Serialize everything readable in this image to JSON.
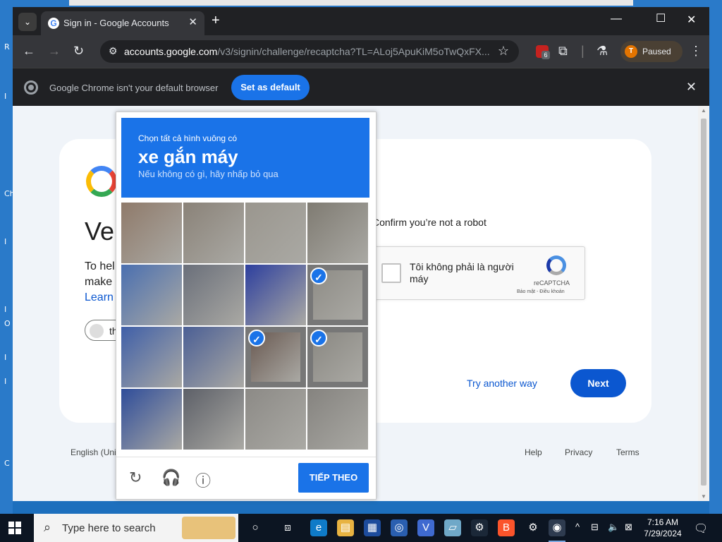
{
  "desktop": {
    "left_glyphs": [
      "R",
      "I",
      "Ch",
      "I",
      "I",
      "O",
      "I",
      "I",
      "C"
    ]
  },
  "tab": {
    "title": "Sign in - Google Accounts",
    "favicon": "G",
    "close": "✕"
  },
  "toolbar": {
    "url_host": "accounts.google.com",
    "url_path": "/v3/signin/challenge/recaptcha?TL=ALoj5ApuKiM5oTwQxFX...",
    "extension_badge_count": "6",
    "profile_initial": "T",
    "profile_status": "Paused"
  },
  "infobar": {
    "message": "Google Chrome isn't your default browser",
    "button": "Set as default"
  },
  "signin": {
    "heading": "Ver",
    "text_line1": "To hel",
    "text_line2": "make",
    "learn": "Learn",
    "chip_text": "th",
    "confirm": "Confirm you’re not a robot",
    "recaptcha_label": "Tôi không phải là người máy",
    "recaptcha_brand": "reCAPTCHA",
    "recaptcha_links": "Bảo mật - Điều khoản",
    "try_another": "Try another way",
    "next": "Next"
  },
  "footer": {
    "language": "English (Uni",
    "help": "Help",
    "privacy": "Privacy",
    "terms": "Terms"
  },
  "challenge": {
    "instruction": "Chọn tất cả hình vuông có",
    "object": "xe gắn máy",
    "hint": "Nếu không có gì, hãy nhấp bỏ qua",
    "verify_button": "TIẾP THEO",
    "cells": [
      {
        "sel": false,
        "color": "#8f7a6a"
      },
      {
        "sel": false,
        "color": "#8a8278"
      },
      {
        "sel": false,
        "color": "#9a968e"
      },
      {
        "sel": false,
        "color": "#7f7b72"
      },
      {
        "sel": false,
        "color": "#4a6fb0"
      },
      {
        "sel": false,
        "color": "#6a6f7a"
      },
      {
        "sel": false,
        "color": "#2d3f9e"
      },
      {
        "sel": true,
        "color": "#8e8c86"
      },
      {
        "sel": false,
        "color": "#3f5fa8"
      },
      {
        "sel": false,
        "color": "#4b5f95"
      },
      {
        "sel": true,
        "color": "#6a5a52"
      },
      {
        "sel": true,
        "color": "#8a8882"
      },
      {
        "sel": false,
        "color": "#2f4d9a"
      },
      {
        "sel": false,
        "color": "#5d6068"
      },
      {
        "sel": false,
        "color": "#8c8a86"
      },
      {
        "sel": false,
        "color": "#85837f"
      }
    ]
  },
  "taskbar": {
    "search_placeholder": "Type here to search",
    "time": "7:16 AM",
    "date": "7/29/2024"
  },
  "colors": {
    "accent": "#1a73e8",
    "next": "#0b57d0"
  }
}
